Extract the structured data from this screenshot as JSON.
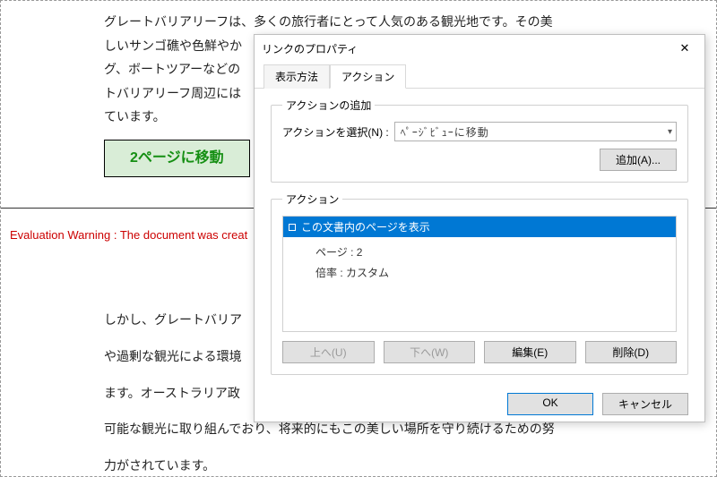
{
  "document": {
    "paragraph1_lines": [
      "グレートバリアリーフは、多くの旅行者にとって人気のある観光地です。その美",
      "しいサンゴ礁や色鮮やか",
      "グ、ボートツアーなどの",
      "トバリアリーフ周辺には",
      "ています。"
    ],
    "link_button": "2ページに移動",
    "eval_warning": "Evaluation Warning : The document was creat",
    "paragraph2_lines": [
      "しかし、グレートバリア",
      "や過剰な観光による環境",
      "ます。オーストラリア政",
      "可能な観光に取り組んでおり、将来的にもこの美しい場所を守り続けるための努",
      "力がされています。"
    ]
  },
  "dialog": {
    "title": "リンクのプロパティ",
    "tabs": {
      "display": "表示方法",
      "actions": "アクション"
    },
    "add": {
      "legend": "アクションの追加",
      "select_label": "アクションを選択(N) :",
      "select_value": "ﾍﾟｰｼﾞﾋﾞｭｰに移動",
      "add_btn": "追加(A)..."
    },
    "actions": {
      "legend": "アクション",
      "item": "この文書内のページを表示",
      "page_label": "ページ :",
      "page_value": "2",
      "zoom_label": "倍率 :",
      "zoom_value": "カスタム",
      "up": "上へ(U)",
      "down": "下へ(W)",
      "edit": "編集(E)",
      "delete": "削除(D)"
    },
    "footer": {
      "ok": "OK",
      "cancel": "キャンセル"
    }
  }
}
